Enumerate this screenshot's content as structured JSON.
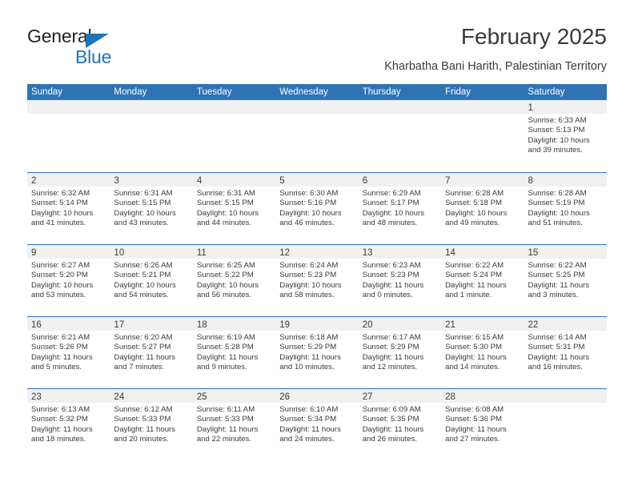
{
  "brand": {
    "name_part1": "General",
    "name_part2": "Blue",
    "triangle_color": "#1b75bb",
    "text_color": "#231f20"
  },
  "header": {
    "title": "February 2025",
    "subtitle": "Kharbatha Bani Harith, Palestinian Territory"
  },
  "colors": {
    "header_blue": "#2e74b5",
    "band_gray": "#f0f0f0",
    "text": "#3a3a3a"
  },
  "weekdays": [
    "Sunday",
    "Monday",
    "Tuesday",
    "Wednesday",
    "Thursday",
    "Friday",
    "Saturday"
  ],
  "weeks": [
    [
      {
        "day": "",
        "empty": true
      },
      {
        "day": "",
        "empty": true
      },
      {
        "day": "",
        "empty": true
      },
      {
        "day": "",
        "empty": true
      },
      {
        "day": "",
        "empty": true
      },
      {
        "day": "",
        "empty": true
      },
      {
        "day": "1",
        "sunrise": "Sunrise: 6:33 AM",
        "sunset": "Sunset: 5:13 PM",
        "daylight": "Daylight: 10 hours and 39 minutes."
      }
    ],
    [
      {
        "day": "2",
        "sunrise": "Sunrise: 6:32 AM",
        "sunset": "Sunset: 5:14 PM",
        "daylight": "Daylight: 10 hours and 41 minutes."
      },
      {
        "day": "3",
        "sunrise": "Sunrise: 6:31 AM",
        "sunset": "Sunset: 5:15 PM",
        "daylight": "Daylight: 10 hours and 43 minutes."
      },
      {
        "day": "4",
        "sunrise": "Sunrise: 6:31 AM",
        "sunset": "Sunset: 5:15 PM",
        "daylight": "Daylight: 10 hours and 44 minutes."
      },
      {
        "day": "5",
        "sunrise": "Sunrise: 6:30 AM",
        "sunset": "Sunset: 5:16 PM",
        "daylight": "Daylight: 10 hours and 46 minutes."
      },
      {
        "day": "6",
        "sunrise": "Sunrise: 6:29 AM",
        "sunset": "Sunset: 5:17 PM",
        "daylight": "Daylight: 10 hours and 48 minutes."
      },
      {
        "day": "7",
        "sunrise": "Sunrise: 6:28 AM",
        "sunset": "Sunset: 5:18 PM",
        "daylight": "Daylight: 10 hours and 49 minutes."
      },
      {
        "day": "8",
        "sunrise": "Sunrise: 6:28 AM",
        "sunset": "Sunset: 5:19 PM",
        "daylight": "Daylight: 10 hours and 51 minutes."
      }
    ],
    [
      {
        "day": "9",
        "sunrise": "Sunrise: 6:27 AM",
        "sunset": "Sunset: 5:20 PM",
        "daylight": "Daylight: 10 hours and 53 minutes."
      },
      {
        "day": "10",
        "sunrise": "Sunrise: 6:26 AM",
        "sunset": "Sunset: 5:21 PM",
        "daylight": "Daylight: 10 hours and 54 minutes."
      },
      {
        "day": "11",
        "sunrise": "Sunrise: 6:25 AM",
        "sunset": "Sunset: 5:22 PM",
        "daylight": "Daylight: 10 hours and 56 minutes."
      },
      {
        "day": "12",
        "sunrise": "Sunrise: 6:24 AM",
        "sunset": "Sunset: 5:23 PM",
        "daylight": "Daylight: 10 hours and 58 minutes."
      },
      {
        "day": "13",
        "sunrise": "Sunrise: 6:23 AM",
        "sunset": "Sunset: 5:23 PM",
        "daylight": "Daylight: 11 hours and 0 minutes."
      },
      {
        "day": "14",
        "sunrise": "Sunrise: 6:22 AM",
        "sunset": "Sunset: 5:24 PM",
        "daylight": "Daylight: 11 hours and 1 minute."
      },
      {
        "day": "15",
        "sunrise": "Sunrise: 6:22 AM",
        "sunset": "Sunset: 5:25 PM",
        "daylight": "Daylight: 11 hours and 3 minutes."
      }
    ],
    [
      {
        "day": "16",
        "sunrise": "Sunrise: 6:21 AM",
        "sunset": "Sunset: 5:26 PM",
        "daylight": "Daylight: 11 hours and 5 minutes."
      },
      {
        "day": "17",
        "sunrise": "Sunrise: 6:20 AM",
        "sunset": "Sunset: 5:27 PM",
        "daylight": "Daylight: 11 hours and 7 minutes."
      },
      {
        "day": "18",
        "sunrise": "Sunrise: 6:19 AM",
        "sunset": "Sunset: 5:28 PM",
        "daylight": "Daylight: 11 hours and 9 minutes."
      },
      {
        "day": "19",
        "sunrise": "Sunrise: 6:18 AM",
        "sunset": "Sunset: 5:29 PM",
        "daylight": "Daylight: 11 hours and 10 minutes."
      },
      {
        "day": "20",
        "sunrise": "Sunrise: 6:17 AM",
        "sunset": "Sunset: 5:29 PM",
        "daylight": "Daylight: 11 hours and 12 minutes."
      },
      {
        "day": "21",
        "sunrise": "Sunrise: 6:15 AM",
        "sunset": "Sunset: 5:30 PM",
        "daylight": "Daylight: 11 hours and 14 minutes."
      },
      {
        "day": "22",
        "sunrise": "Sunrise: 6:14 AM",
        "sunset": "Sunset: 5:31 PM",
        "daylight": "Daylight: 11 hours and 16 minutes."
      }
    ],
    [
      {
        "day": "23",
        "sunrise": "Sunrise: 6:13 AM",
        "sunset": "Sunset: 5:32 PM",
        "daylight": "Daylight: 11 hours and 18 minutes."
      },
      {
        "day": "24",
        "sunrise": "Sunrise: 6:12 AM",
        "sunset": "Sunset: 5:33 PM",
        "daylight": "Daylight: 11 hours and 20 minutes."
      },
      {
        "day": "25",
        "sunrise": "Sunrise: 6:11 AM",
        "sunset": "Sunset: 5:33 PM",
        "daylight": "Daylight: 11 hours and 22 minutes."
      },
      {
        "day": "26",
        "sunrise": "Sunrise: 6:10 AM",
        "sunset": "Sunset: 5:34 PM",
        "daylight": "Daylight: 11 hours and 24 minutes."
      },
      {
        "day": "27",
        "sunrise": "Sunrise: 6:09 AM",
        "sunset": "Sunset: 5:35 PM",
        "daylight": "Daylight: 11 hours and 26 minutes."
      },
      {
        "day": "28",
        "sunrise": "Sunrise: 6:08 AM",
        "sunset": "Sunset: 5:36 PM",
        "daylight": "Daylight: 11 hours and 27 minutes."
      },
      {
        "day": "",
        "empty": true
      }
    ]
  ]
}
